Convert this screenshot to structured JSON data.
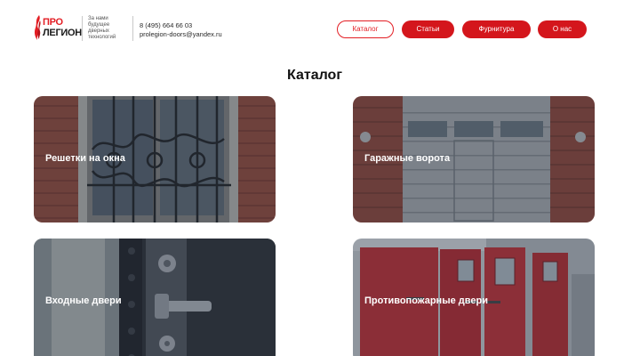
{
  "header": {
    "logo": {
      "line1_red": "ПРО",
      "line2": "ЛЕГИОН"
    },
    "tagline": "За нами будущее дверных технологий",
    "phone": "8 (495) 664 66 03",
    "email": "prolegion-doors@yandex.ru"
  },
  "nav": [
    {
      "label": "Каталог",
      "active": true
    },
    {
      "label": "Статьи",
      "active": false
    },
    {
      "label": "Фурнитура",
      "active": false
    },
    {
      "label": "О нас",
      "active": false
    }
  ],
  "page_title": "Каталог",
  "cards": [
    {
      "label": "Решетки на окна"
    },
    {
      "label": "Гаражные ворота"
    },
    {
      "label": "Входные двери"
    },
    {
      "label": "Противопожарные двери"
    }
  ],
  "colors": {
    "accent": "#e31e24",
    "overlay": "#283446"
  }
}
